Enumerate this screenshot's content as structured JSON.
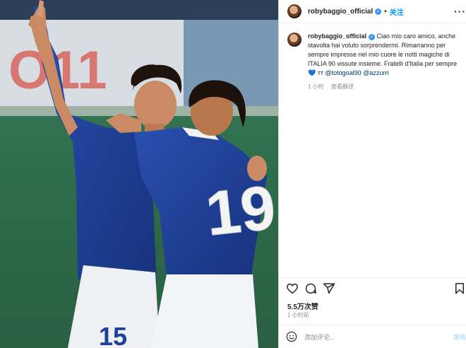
{
  "header": {
    "username": "robybaggio_official",
    "separator": "•",
    "follow_label": "关注",
    "more_icon": "more-horizontal-icon"
  },
  "caption": {
    "username": "robybaggio_official",
    "text_main": "Ciao mio caro amico, anche stavolta hai voluto sorprendermi. Rimarranno per sempre impresse nel mio cuore le notti magiche di ITALIA 90 vissute insieme. Fratelli d'Italia per sempre",
    "heart_emoji": "💙",
    "trailing": "ᴛᴛ",
    "mention_1": "@totogoal90",
    "mention_2": "@azzurri",
    "time": "1 小时",
    "translate": "查看翻译"
  },
  "actions": {
    "like_icon": "heart-icon",
    "comment_icon": "comment-icon",
    "share_icon": "share-icon",
    "save_icon": "bookmark-icon"
  },
  "likes": "5.5万次赞",
  "time_ago": "1 小时前",
  "comment_box": {
    "placeholder": "添加评论...",
    "post_label": "发布",
    "emoji_icon": "emoji-icon"
  },
  "photo": {
    "jersey_number_front": "19",
    "jersey_number_back": "15",
    "banner_text": "O11"
  },
  "colors": {
    "accent": "#0095f6",
    "verified": "#3897f0",
    "jersey": "#1f3f9a"
  }
}
